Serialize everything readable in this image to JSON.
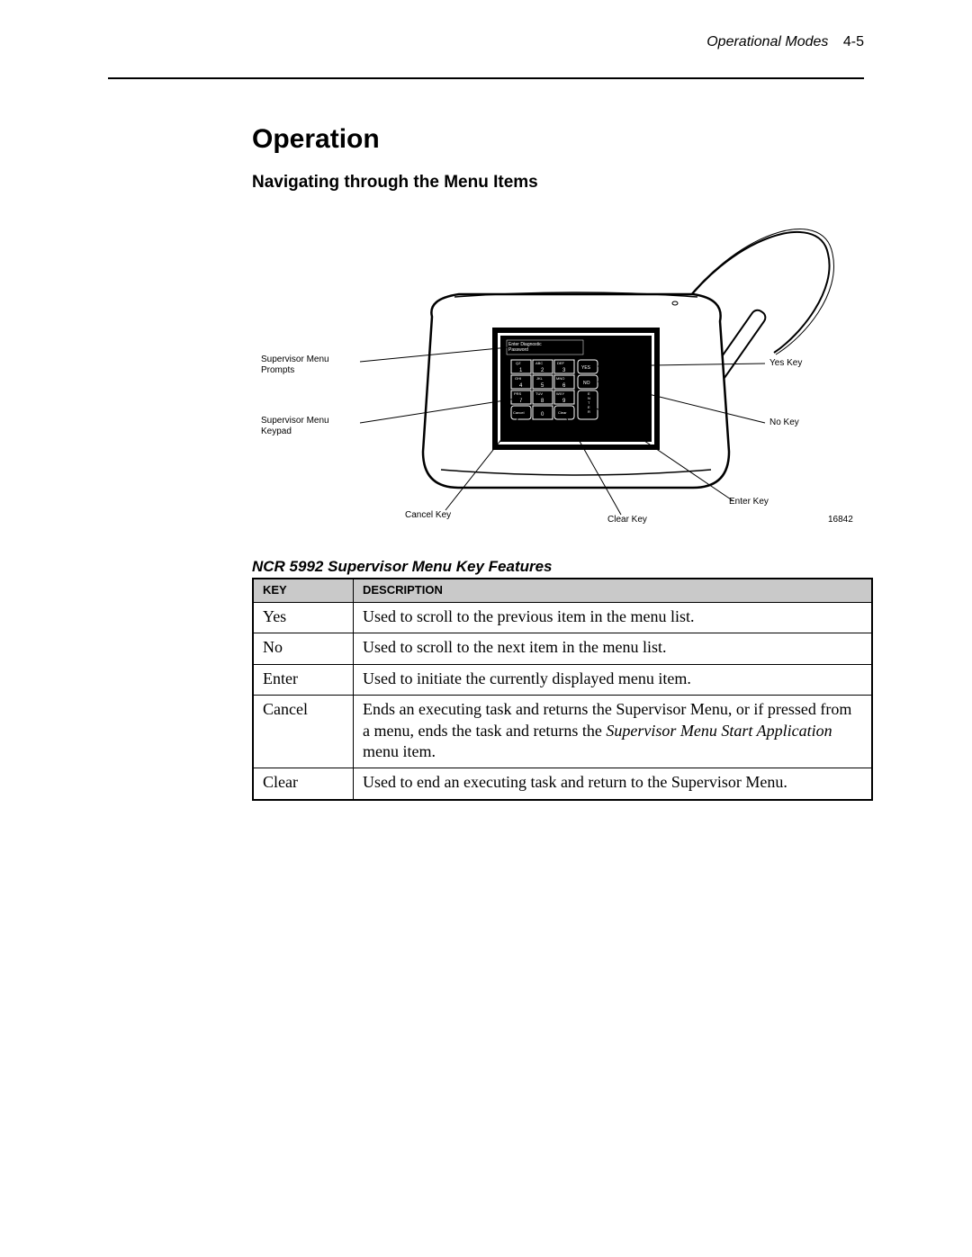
{
  "header": {
    "chapter": "Operational Modes",
    "page": "4-5"
  },
  "section_title": "Operation",
  "subsection_title": "Navigating through the Menu Items",
  "figure": {
    "labels": {
      "prompts": "Supervisor Menu\nPrompts",
      "keypad": "Supervisor  Menu\nKeypad",
      "yes": "Yes Key",
      "no": "No Key",
      "enter": "Enter Key",
      "cancel": "Cancel Key",
      "clear": "Clear Key",
      "id": "16842"
    },
    "screen_text": "Enter Diagnostic\nPassword",
    "keypad": {
      "rows": [
        [
          {
            "t": "QZ",
            "n": "1"
          },
          {
            "t": "ABC",
            "n": "2"
          },
          {
            "t": "DEF",
            "n": "3"
          },
          {
            "t": "YES",
            "n": ""
          }
        ],
        [
          {
            "t": "GHI",
            "n": "4"
          },
          {
            "t": "JKL",
            "n": "5"
          },
          {
            "t": "MNO",
            "n": "6"
          },
          {
            "t": "NO",
            "n": ""
          }
        ],
        [
          {
            "t": "PRS",
            "n": "7"
          },
          {
            "t": "TUV",
            "n": "8"
          },
          {
            "t": "WXY",
            "n": "9"
          },
          {
            "t": "",
            "n": ""
          }
        ],
        [
          {
            "t": "Cancel",
            "n": ""
          },
          {
            "t": "",
            "n": "0"
          },
          {
            "t": "Clear",
            "n": ""
          },
          {
            "t": "",
            "n": ""
          }
        ]
      ],
      "enter_label": "ENTER"
    }
  },
  "table": {
    "caption": "NCR 5992 Supervisor Menu Key Features",
    "headers": {
      "key": "KEY",
      "desc": "DESCRIPTION"
    },
    "rows": [
      {
        "key": "Yes",
        "desc": "Used to scroll to the previous item in the menu list."
      },
      {
        "key": "No",
        "desc": "Used to scroll to the next item in the menu list."
      },
      {
        "key": "Enter",
        "desc": "Used to initiate the currently displayed menu item."
      },
      {
        "key": "Cancel",
        "desc_pre": "Ends an executing task and returns the Supervisor Menu, or if pressed from a menu, ends the task and returns the ",
        "desc_em": "Supervisor Menu Start Application",
        "desc_post": " menu item."
      },
      {
        "key": "Clear",
        "desc": "Used to end an executing task and return to the Supervisor Menu."
      }
    ]
  }
}
